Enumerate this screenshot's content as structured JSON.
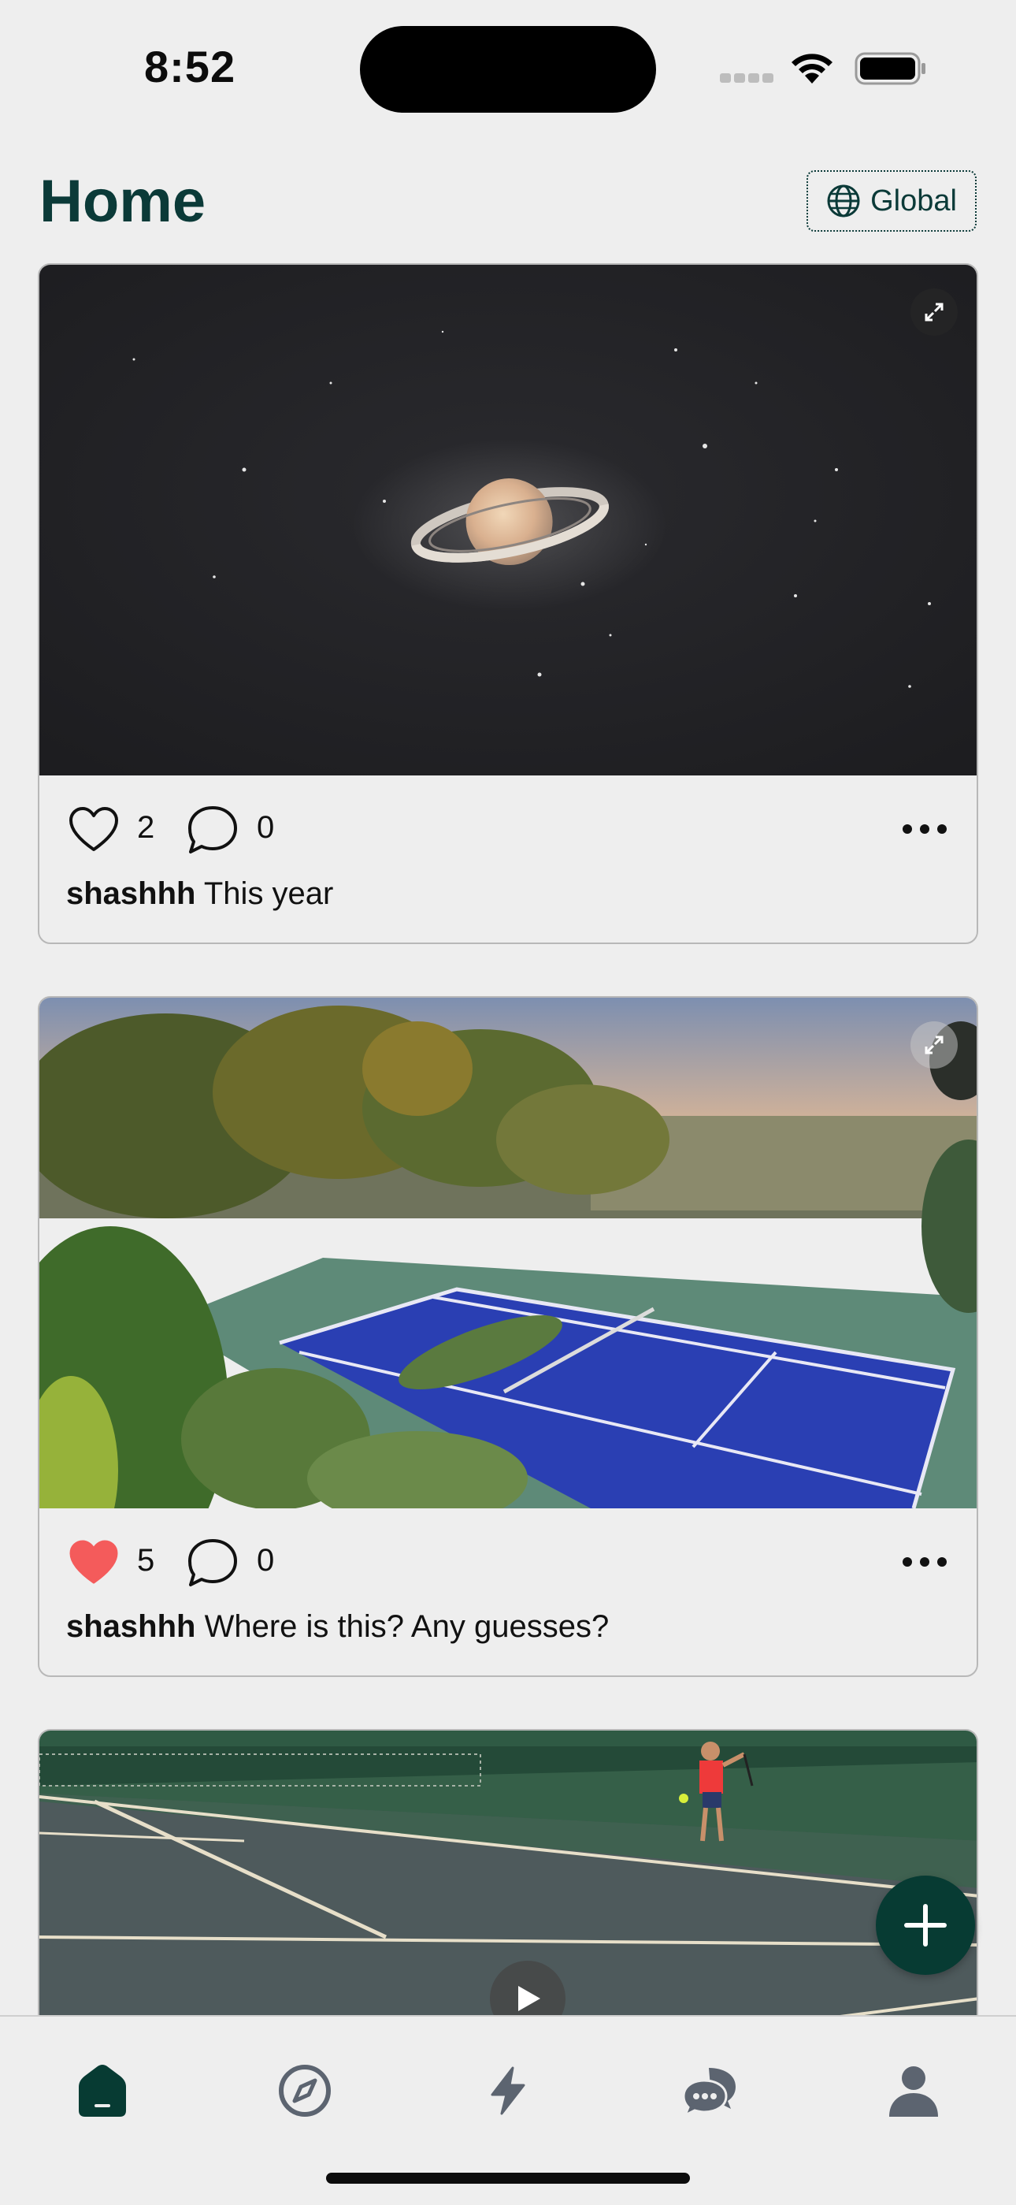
{
  "status_bar": {
    "time": "8:52"
  },
  "header": {
    "title": "Home",
    "global_label": "Global"
  },
  "posts": [
    {
      "username": "shashhh",
      "caption": "This year",
      "likes": "2",
      "comments": "0",
      "liked": false,
      "image": "saturn-night-sky"
    },
    {
      "username": "shashhh",
      "caption": "Where is this? Any guesses?",
      "likes": "5",
      "comments": "0",
      "liked": true,
      "image": "hillside-tennis-court"
    },
    {
      "image": "indoor-tennis-video",
      "is_video": true
    }
  ],
  "tab_bar": {
    "items": [
      {
        "icon": "home-icon",
        "active": true
      },
      {
        "icon": "compass-icon",
        "active": false
      },
      {
        "icon": "lightning-icon",
        "active": false
      },
      {
        "icon": "chat-bubbles-icon",
        "active": false
      },
      {
        "icon": "profile-icon",
        "active": false
      }
    ]
  },
  "colors": {
    "brand": "#0b3a38",
    "fab": "#073b33",
    "like_active": "#f45b5b",
    "tab_inactive": "#5c6470",
    "background": "#eeeeee"
  }
}
